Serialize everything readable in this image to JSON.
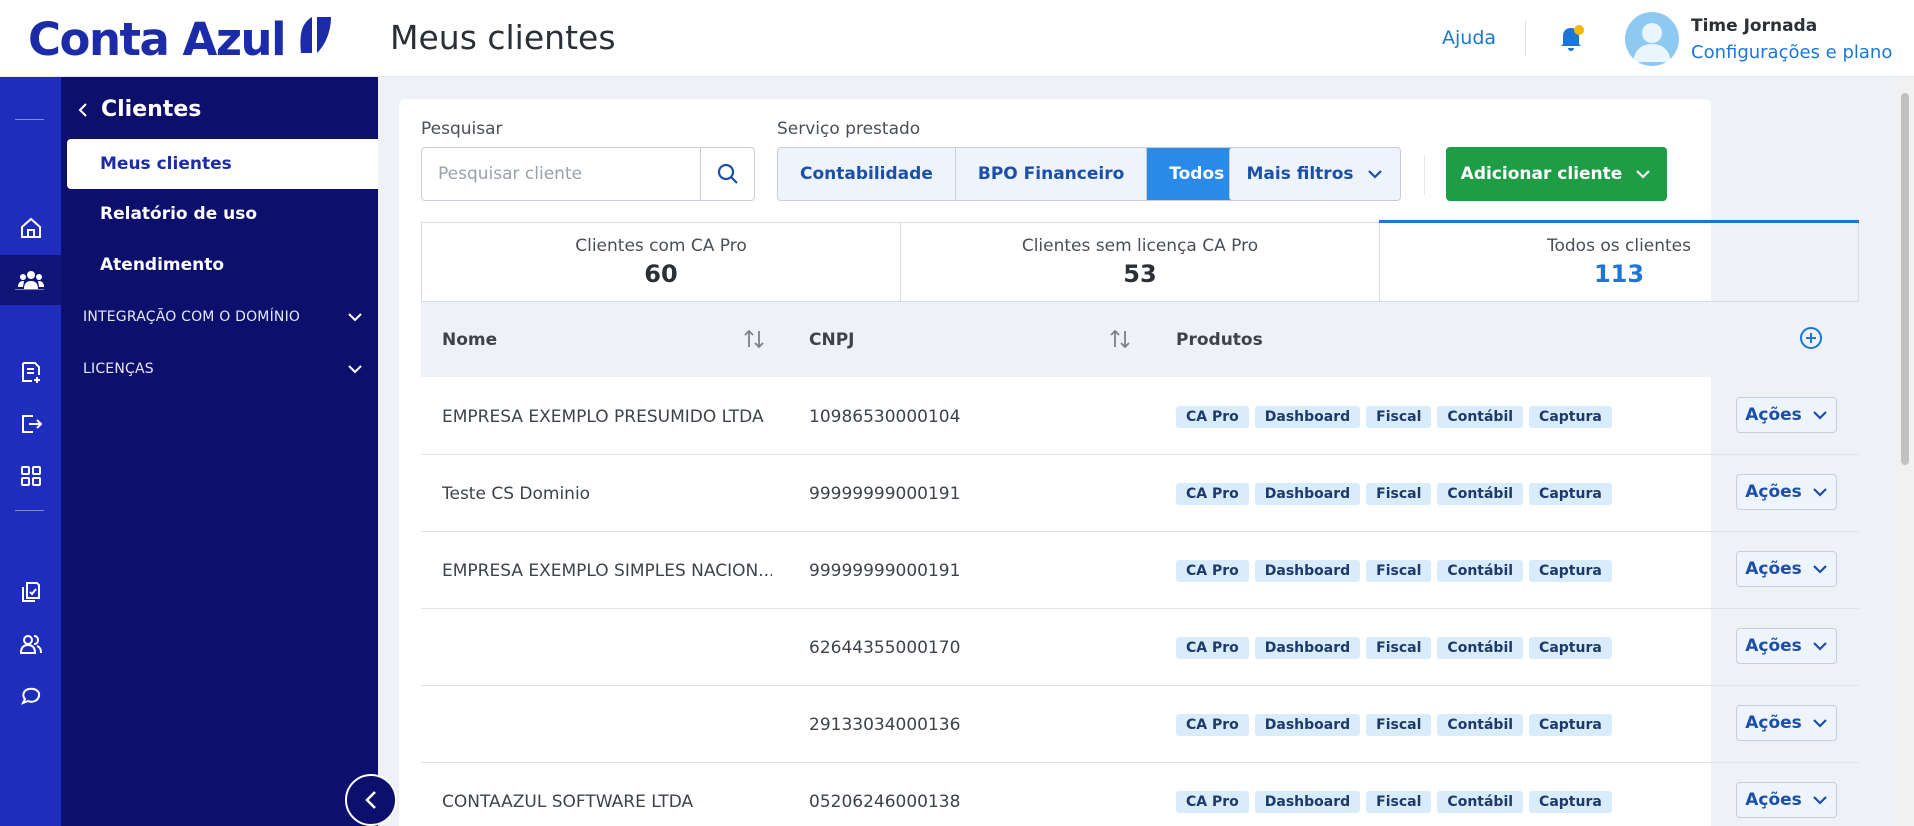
{
  "brand": {
    "name": "Conta Azul",
    "primary": "#1c2ba8",
    "rail_bg": "#1f2dbd",
    "sidebar_bg": "#0c0f6b",
    "accent": "#1b76d8",
    "success": "#1e9c46"
  },
  "header": {
    "title": "Meus clientes",
    "help": "Ajuda",
    "user_name": "Time Jornada",
    "user_link": "Configurações e plano"
  },
  "rail": {
    "icons": [
      "home-icon",
      "clients-icon",
      "document-add-icon",
      "export-icon",
      "apps-grid-icon",
      "files-icon",
      "users-icon",
      "chat-icon"
    ],
    "active": "clients-icon"
  },
  "sidebar": {
    "back_label": "Clientes",
    "items": [
      {
        "label": "Meus clientes",
        "active": true
      },
      {
        "label": "Relatório de uso",
        "active": false
      },
      {
        "label": "Atendimento",
        "active": false
      }
    ],
    "groups": [
      {
        "label": "INTEGRAÇÃO COM O DOMÍNIO"
      },
      {
        "label": "LICENÇAS"
      }
    ]
  },
  "filters": {
    "search_label": "Pesquisar",
    "search_placeholder": "Pesquisar cliente",
    "service_label": "Serviço prestado",
    "services": [
      "Contabilidade",
      "BPO Financeiro",
      "Todos"
    ],
    "service_selected": "Todos",
    "more_filters": "Mais filtros",
    "add_client": "Adicionar cliente"
  },
  "stats": [
    {
      "label": "Clientes com CA Pro",
      "value": "60",
      "active": false
    },
    {
      "label": "Clientes sem licença CA Pro",
      "value": "53",
      "active": false
    },
    {
      "label": "Todos os clientes",
      "value": "113",
      "active": true
    }
  ],
  "table": {
    "columns": [
      "Nome",
      "CNPJ",
      "Produtos"
    ],
    "action_label": "Ações",
    "rows": [
      {
        "name": "EMPRESA EXEMPLO PRESUMIDO LTDA",
        "cnpj": "10986530000104",
        "products": [
          "CA Pro",
          "Dashboard",
          "Fiscal",
          "Contábil",
          "Captura"
        ]
      },
      {
        "name": "Teste CS Dominio",
        "cnpj": "99999999000191",
        "products": [
          "CA Pro",
          "Dashboard",
          "Fiscal",
          "Contábil",
          "Captura"
        ]
      },
      {
        "name": "EMPRESA EXEMPLO SIMPLES NACION...",
        "cnpj": "99999999000191",
        "products": [
          "CA Pro",
          "Dashboard",
          "Fiscal",
          "Contábil",
          "Captura"
        ]
      },
      {
        "name": "",
        "cnpj": "62644355000170",
        "products": [
          "CA Pro",
          "Dashboard",
          "Fiscal",
          "Contábil",
          "Captura"
        ]
      },
      {
        "name": "",
        "cnpj": "29133034000136",
        "products": [
          "CA Pro",
          "Dashboard",
          "Fiscal",
          "Contábil",
          "Captura"
        ]
      },
      {
        "name": "CONTAAZUL SOFTWARE LTDA",
        "cnpj": "05206246000138",
        "products": [
          "CA Pro",
          "Dashboard",
          "Fiscal",
          "Contábil",
          "Captura"
        ]
      }
    ]
  }
}
